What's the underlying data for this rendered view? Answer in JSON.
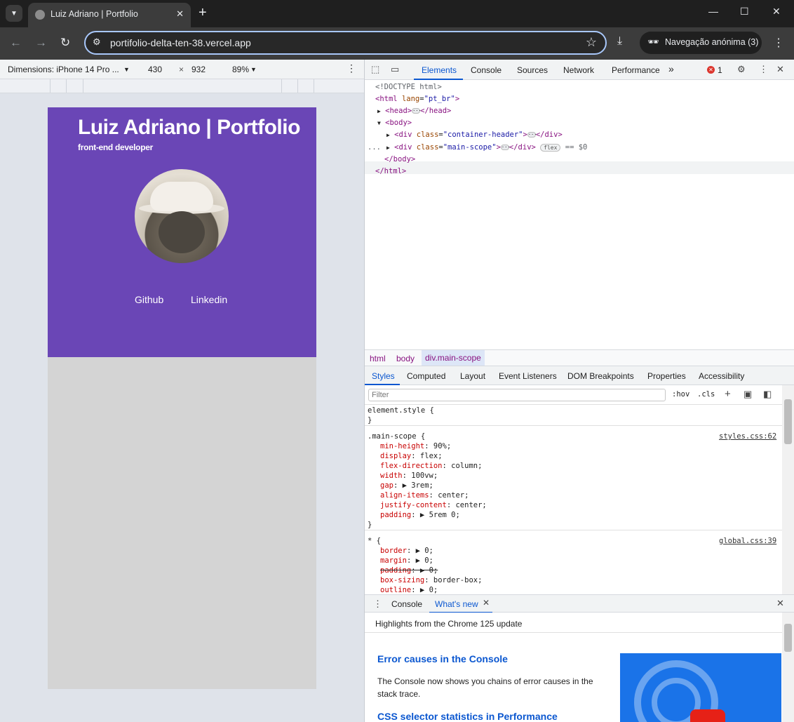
{
  "browser": {
    "tab_title": "Luiz Adriano | Portfolio",
    "url": "portifolio-delta-ten-38.vercel.app",
    "profile_label": "Navegação anónima (3)"
  },
  "device_toolbar": {
    "dimensions_label": "Dimensions: iPhone 14 Pro ...",
    "width": "430",
    "times": "×",
    "height": "932",
    "zoom": "89%"
  },
  "page": {
    "title": "Luiz Adriano | Portfolio",
    "subtitle": "front-end developer",
    "links": [
      "Github",
      "Linkedin"
    ],
    "header_color": "#6a46b6",
    "body_color": "#d4d4d4"
  },
  "devtools": {
    "tabs": [
      "Elements",
      "Console",
      "Sources",
      "Network",
      "Performance"
    ],
    "more": "»",
    "error_count": "1",
    "dom": {
      "doctype": "<!DOCTYPE html>",
      "html_open_tag": "<html",
      "html_attr": "lang",
      "html_attr_val": "\"pt_br\"",
      "head_open": "<head>",
      "head_close": "</head>",
      "body_open": "<body>",
      "div_open": "<div",
      "class_attr": "class",
      "div1_class": "\"container-header\"",
      "div2_class": "\"main-scope\"",
      "div_close": "</div>",
      "flex_badge": "flex",
      "eq_label": "== $0",
      "body_close": "</body>",
      "html_close": "</html>",
      "gutter_dots": "..."
    },
    "breadcrumbs": [
      "html",
      "body",
      "div.main-scope"
    ],
    "style_tabs": [
      "Styles",
      "Computed",
      "Layout",
      "Event Listeners",
      "DOM Breakpoints",
      "Properties",
      "Accessibility"
    ],
    "filter_placeholder": "Filter",
    "hov": ":hov",
    "cls": ".cls",
    "rules": {
      "element_style": "element.style {",
      "close": "}",
      "main_selector": ".main-scope {",
      "main_source": "styles.css:62",
      "main_props": [
        {
          "p": "min-height",
          "v": "90%;"
        },
        {
          "p": "display",
          "v": "flex;"
        },
        {
          "p": "flex-direction",
          "v": "column;"
        },
        {
          "p": "width",
          "v": "100vw;"
        },
        {
          "p": "gap",
          "v": "▶ 3rem;"
        },
        {
          "p": "align-items",
          "v": "center;"
        },
        {
          "p": "justify-content",
          "v": "center;"
        },
        {
          "p": "padding",
          "v": "▶ 5rem 0;"
        }
      ],
      "star_selector": "* {",
      "star_source": "global.css:39",
      "star_props": [
        {
          "p": "border",
          "v": "▶ 0;"
        },
        {
          "p": "margin",
          "v": "▶ 0;"
        },
        {
          "p": "padding",
          "v": "▶ 0;"
        },
        {
          "p": "box-sizing",
          "v": "border-box;"
        },
        {
          "p": "outline",
          "v": "▶ 0;"
        }
      ]
    },
    "drawer": {
      "tabs": [
        "Console",
        "What's new"
      ],
      "headline": "Highlights from the Chrome 125 update",
      "item1_title": "Error causes in the Console",
      "item1_text": "The Console now shows you chains of error causes in the stack trace.",
      "item2_title": "CSS selector statistics in Performance"
    }
  }
}
